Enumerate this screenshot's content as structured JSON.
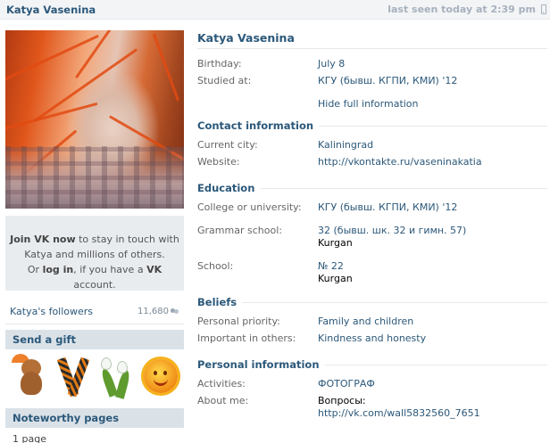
{
  "topbar": {
    "name": "Katya Vasenina",
    "last_seen": "last seen today at 2:39 pm",
    "device_icon": "mobile-phone-icon"
  },
  "left": {
    "photo_alt": "",
    "join": {
      "line1_bold": "Join VK now",
      "line1_rest": " to stay in touch with",
      "line2": "Katya and millions of others.",
      "line3_pre": "Or ",
      "line3_login": "log in",
      "line3_mid": ", if you have a ",
      "line3_vk": "VK",
      "line3_post": " account."
    },
    "followers": {
      "label": "Katya's followers",
      "count": "11,680"
    },
    "gift_header": "Send a gift",
    "gifts": [
      "bear-with-umbrella-icon",
      "st-george-ribbon-icon",
      "snowdrop-icon",
      "smiling-sun-icon"
    ],
    "noteworthy_header": "Noteworthy pages",
    "noteworthy_count": "1 page"
  },
  "profile": {
    "name": "Katya Vasenina",
    "basic": [
      {
        "key": "Birthday:",
        "value": "July 8"
      },
      {
        "key": "Studied at:",
        "value": "КГУ (бывш. КГПИ, КМИ) '12"
      }
    ],
    "hide_link": "Hide full information",
    "sections": [
      {
        "title": "Contact information",
        "rows": [
          {
            "key": "Current city:",
            "value": "Kaliningrad"
          },
          {
            "key": "Website:",
            "value": "http://vkontakte.ru/vaseninakatia"
          }
        ]
      },
      {
        "title": "Education",
        "rows": [
          {
            "key": "College or university:",
            "value": "КГУ (бывш. КГПИ, КМИ) '12"
          },
          {
            "key": "Grammar school:",
            "value": "32 (бывш. шк. 32 и гимн. 57)",
            "sub": "Kurgan"
          },
          {
            "key": "School:",
            "value": "№ 22",
            "sub": "Kurgan"
          }
        ]
      },
      {
        "title": "Beliefs",
        "rows": [
          {
            "key": "Personal priority:",
            "value": "Family and children"
          },
          {
            "key": "Important in others:",
            "value": "Kindness and honesty"
          }
        ]
      },
      {
        "title": "Personal information",
        "rows": [
          {
            "key": "Activities:",
            "value": "ФОТОГРАФ"
          },
          {
            "key": "About me:",
            "value_plain": "Вопросы:",
            "value": "http://vk.com/wall5832560_7651"
          }
        ]
      }
    ]
  }
}
